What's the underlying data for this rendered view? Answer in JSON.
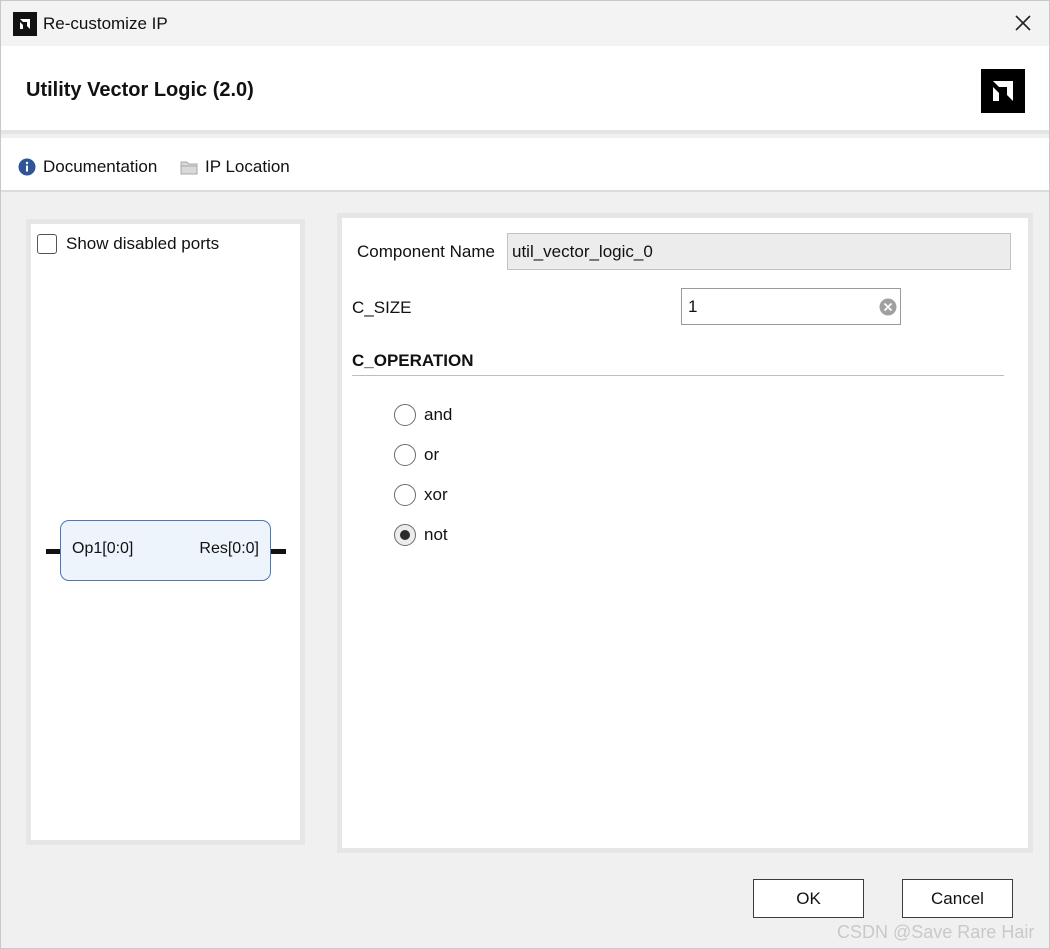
{
  "window": {
    "title": "Re-customize IP",
    "close_icon": "close-icon",
    "app_icon": "amd-logo-icon"
  },
  "header": {
    "ip_title": "Utility Vector Logic (2.0)",
    "brand_icon": "amd-logo-icon"
  },
  "toolbar": {
    "documentation": "Documentation",
    "ip_location": "IP Location",
    "documentation_icon": "info-icon",
    "ip_location_icon": "folder-icon",
    "info_color": "#2f5597"
  },
  "left_pane": {
    "show_disabled_ports": "Show disabled ports",
    "show_disabled_checked": false,
    "block": {
      "input_port": "Op1[0:0]",
      "output_port": "Res[0:0]"
    }
  },
  "right_pane": {
    "component_name_label": "Component Name",
    "component_name_value": "util_vector_logic_0",
    "c_size_label": "C_SIZE",
    "c_size_value": "1",
    "c_operation_title": "C_OPERATION",
    "operations": [
      {
        "label": "and",
        "selected": false
      },
      {
        "label": "or",
        "selected": false
      },
      {
        "label": "xor",
        "selected": false
      },
      {
        "label": "not",
        "selected": true
      }
    ]
  },
  "buttons": {
    "ok": "OK",
    "cancel": "Cancel"
  },
  "watermark": "CSDN @Save Rare Hair"
}
